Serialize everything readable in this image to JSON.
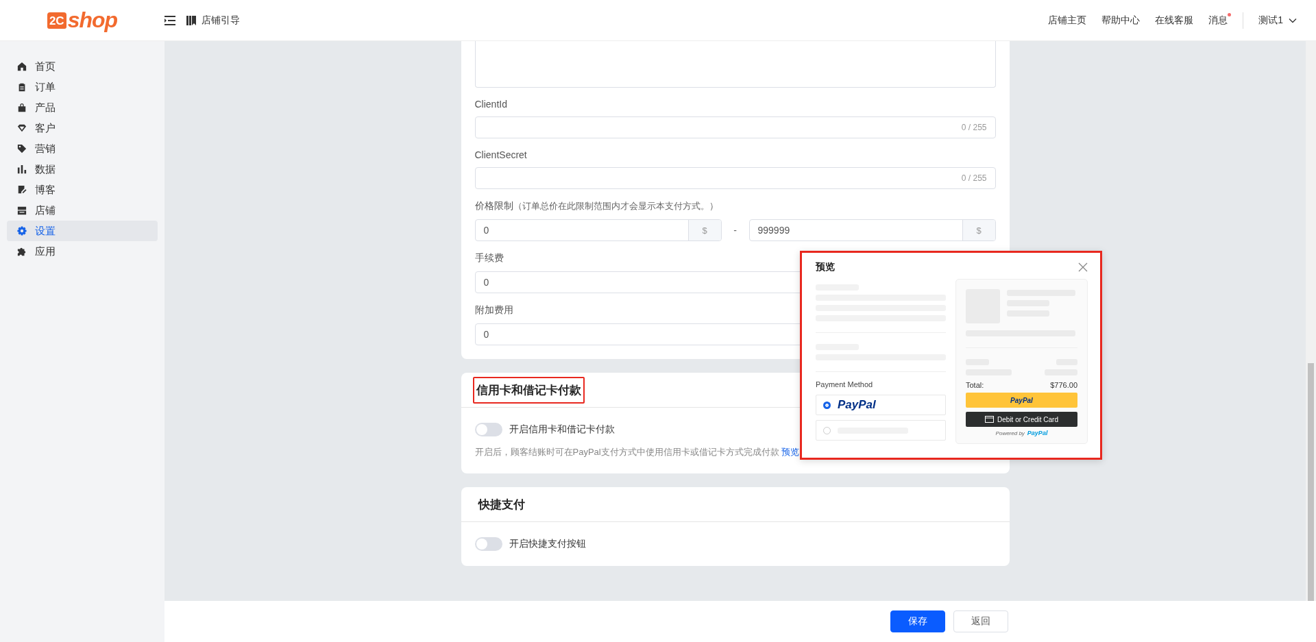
{
  "header": {
    "logo_mark": "2C",
    "logo_word": "shop",
    "guide": "店铺引导",
    "links": [
      "店铺主页",
      "帮助中心",
      "在线客服"
    ],
    "messages": {
      "label": "消息",
      "unread": true
    },
    "user": "测试1"
  },
  "sidebar": {
    "items": [
      {
        "label": "首页",
        "selected": false
      },
      {
        "label": "订单",
        "selected": false
      },
      {
        "label": "产品",
        "selected": false
      },
      {
        "label": "客户",
        "selected": false
      },
      {
        "label": "营销",
        "selected": false
      },
      {
        "label": "数据",
        "selected": false
      },
      {
        "label": "博客",
        "selected": false
      },
      {
        "label": "店铺",
        "selected": false
      },
      {
        "label": "设置",
        "selected": true
      },
      {
        "label": "应用",
        "selected": false
      }
    ]
  },
  "form": {
    "fields": [
      {
        "label": "ClientId",
        "counter": "0 / 255"
      },
      {
        "label": "ClientSecret",
        "counter": "0 / 255"
      }
    ],
    "price": {
      "label": "价格限制",
      "hint": "（订单总价在此限制范围内才会显示本支付方式。）",
      "min": {
        "value": "0",
        "unit": "$"
      },
      "separator": "-",
      "max": {
        "value": "999999",
        "unit": "$"
      }
    },
    "fees": [
      {
        "label": "手续费",
        "value": "0"
      },
      {
        "label": "附加费用",
        "value": "0"
      }
    ]
  },
  "sections": [
    {
      "title": "信用卡和借记卡付款",
      "highlighted": true,
      "toggle": {
        "label": "开启信用卡和借记卡付款",
        "on": false
      },
      "description": "开启后，顾客结账时可在PayPal支付方式中使用信用卡或借记卡方式完成付款",
      "link": "预览"
    },
    {
      "title": "快捷支付",
      "highlighted": false,
      "toggle": {
        "label": "开启快捷支付按钮",
        "on": false
      }
    }
  ],
  "footer": {
    "buttons": [
      {
        "label": "保存",
        "kind": "primary"
      },
      {
        "label": "返回",
        "kind": "default"
      }
    ]
  },
  "preview": {
    "title": "预览",
    "highlighted": true,
    "payment_method": "Payment Method",
    "options": [
      {
        "label": "PayPal",
        "selected": true
      },
      {
        "selected": false
      }
    ],
    "total_label": "Total:",
    "total": "$776.00",
    "paypal_button": "PayPal",
    "card_button": "Debit or Credit Card",
    "powered_by": "Powered by",
    "powered_brand": "PayPal"
  }
}
